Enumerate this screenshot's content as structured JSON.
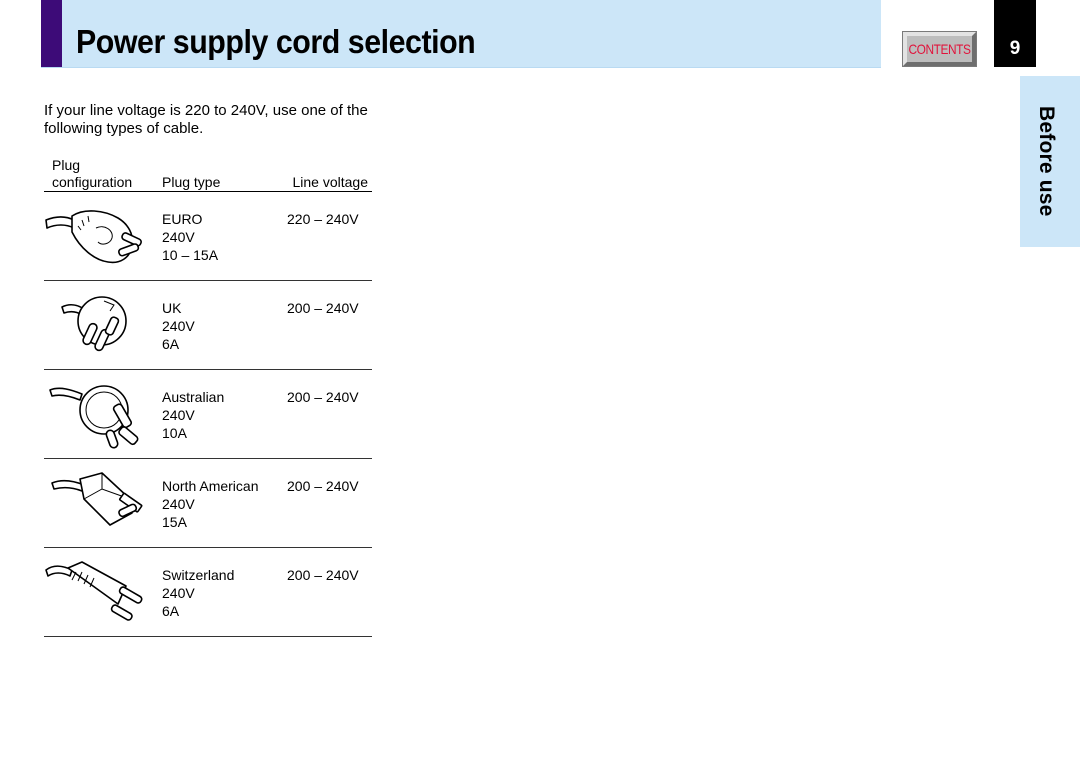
{
  "header": {
    "title": "Power supply cord selection",
    "contents_label": "CONTENTS",
    "page_number": "9",
    "section_tab": "Before use",
    "colors": {
      "header_bg": "#cce6f8",
      "accent": "#3d0b78",
      "contents_text": "#e0143c"
    }
  },
  "intro": "If your line voltage is 220 to 240V, use one of the following types of cable.",
  "table": {
    "headers": {
      "config_line1": "Plug",
      "config_line2": "configuration",
      "type": "Plug type",
      "voltage": "Line voltage"
    },
    "rows": [
      {
        "icon": "euro-plug-icon",
        "type": "EURO",
        "rating_v": "240V",
        "rating_a": "10 – 15A",
        "line_voltage": "220 – 240V"
      },
      {
        "icon": "uk-plug-icon",
        "type": "UK",
        "rating_v": "240V",
        "rating_a": "6A",
        "line_voltage": "200 – 240V"
      },
      {
        "icon": "australian-plug-icon",
        "type": "Australian",
        "rating_v": "240V",
        "rating_a": "10A",
        "line_voltage": "200 – 240V"
      },
      {
        "icon": "north-american-plug-icon",
        "type": "North American",
        "rating_v": "240V",
        "rating_a": "15A",
        "line_voltage": "200 – 240V"
      },
      {
        "icon": "switzerland-plug-icon",
        "type": "Switzerland",
        "rating_v": "240V",
        "rating_a": "6A",
        "line_voltage": "200 – 240V"
      }
    ]
  }
}
